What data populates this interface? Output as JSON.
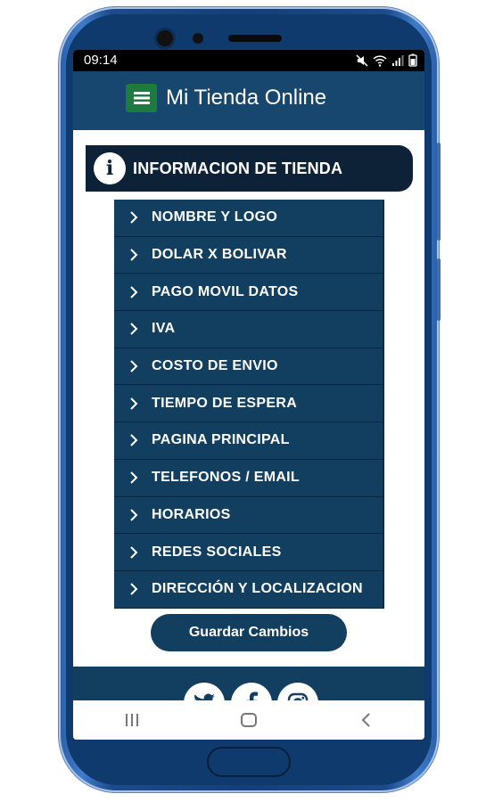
{
  "status_bar": {
    "time": "09:14",
    "icons": [
      "mute-icon",
      "wifi-icon",
      "signal-icon",
      "battery-icon"
    ]
  },
  "app_bar": {
    "title": "Mi Tienda Online",
    "menu_icon": "hamburger-icon"
  },
  "section": {
    "icon": "info-icon",
    "icon_text": "i",
    "title": "INFORMACION DE TIENDA"
  },
  "menu_items": [
    {
      "label": "NOMBRE Y LOGO"
    },
    {
      "label": "DOLAR X BOLIVAR"
    },
    {
      "label": "PAGO MOVIL DATOS"
    },
    {
      "label": "IVA"
    },
    {
      "label": "COSTO DE ENVIO"
    },
    {
      "label": "TIEMPO DE ESPERA"
    },
    {
      "label": "PAGINA PRINCIPAL"
    },
    {
      "label": "TELEFONOS / EMAIL"
    },
    {
      "label": "HORARIOS"
    },
    {
      "label": "REDES SOCIALES"
    },
    {
      "label": "DIRECCIÓN Y LOCALIZACION"
    }
  ],
  "save_button": {
    "label": "Guardar Cambios"
  },
  "social_icons": [
    "twitter-icon",
    "facebook-icon",
    "instagram-icon"
  ],
  "nav_bar": [
    "recent-apps-icon",
    "home-icon",
    "back-icon"
  ],
  "colors": {
    "app_bar": "#17476e",
    "menu_item": "#123f60",
    "section_header": "#0d2236",
    "menu_button": "#1f7a3f"
  }
}
